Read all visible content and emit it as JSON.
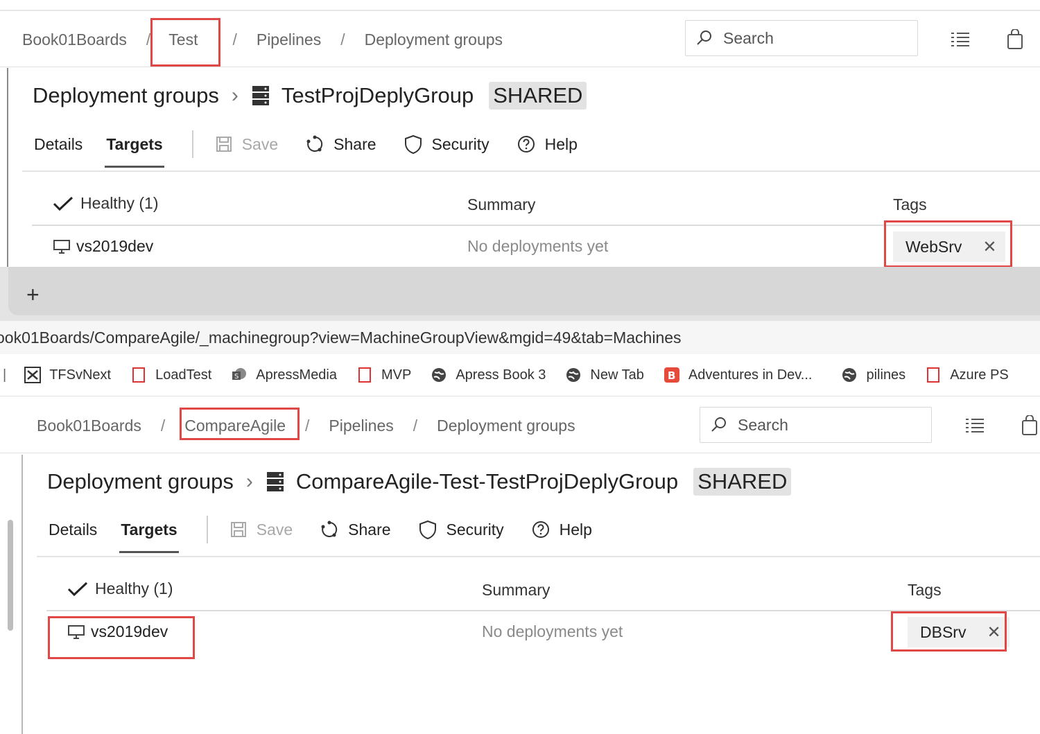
{
  "top": {
    "breadcrumb": [
      "Book01Boards",
      "Test",
      "Pipelines",
      "Deployment groups"
    ],
    "separator": "/",
    "search_placeholder": "Search",
    "page_title": "Deployment groups",
    "group_name": "TestProjDeplyGroup",
    "badge": "SHARED",
    "tabs": [
      "Details",
      "Targets"
    ],
    "commands": [
      "Save",
      "Share",
      "Security",
      "Help"
    ],
    "health_header": "Healthy (1)",
    "summary_header": "Summary",
    "tags_header": "Tags",
    "row": {
      "name": "vs2019dev",
      "summary": "No deployments yet",
      "tag": "WebSrv"
    }
  },
  "browser": {
    "new_tab": "+",
    "address": "ook01Boards/CompareAgile/_machinegroup?view=MachineGroupView&mgid=49&tab=Machines",
    "bookmarks": [
      "TFSvNext",
      "LoadTest",
      "ApressMedia",
      "MVP",
      "Apress Book 3",
      "New Tab",
      "Adventures in Dev...",
      "pilines",
      "Azure PS"
    ]
  },
  "bottom": {
    "breadcrumb": [
      "Book01Boards",
      "CompareAgile",
      "Pipelines",
      "Deployment groups"
    ],
    "separator": "/",
    "search_placeholder": "Search",
    "page_title": "Deployment groups",
    "group_name": "CompareAgile-Test-TestProjDeplyGroup",
    "badge": "SHARED",
    "tabs": [
      "Details",
      "Targets"
    ],
    "commands": [
      "Save",
      "Share",
      "Security",
      "Help"
    ],
    "health_header": "Healthy (1)",
    "summary_header": "Summary",
    "tags_header": "Tags",
    "row": {
      "name": "vs2019dev",
      "summary": "No deployments yet",
      "tag": "DBSrv"
    }
  },
  "colors": {
    "highlight": "#e04848",
    "badge_bg": "#e2e2e2",
    "muted_text": "#8a8a8a"
  },
  "icons": [
    "search-icon",
    "list-icon",
    "shopping-bag-icon",
    "server-icon",
    "save-icon",
    "share-icon",
    "shield-icon",
    "help-icon",
    "check-icon",
    "computer-icon",
    "close-icon",
    "plus-icon"
  ]
}
